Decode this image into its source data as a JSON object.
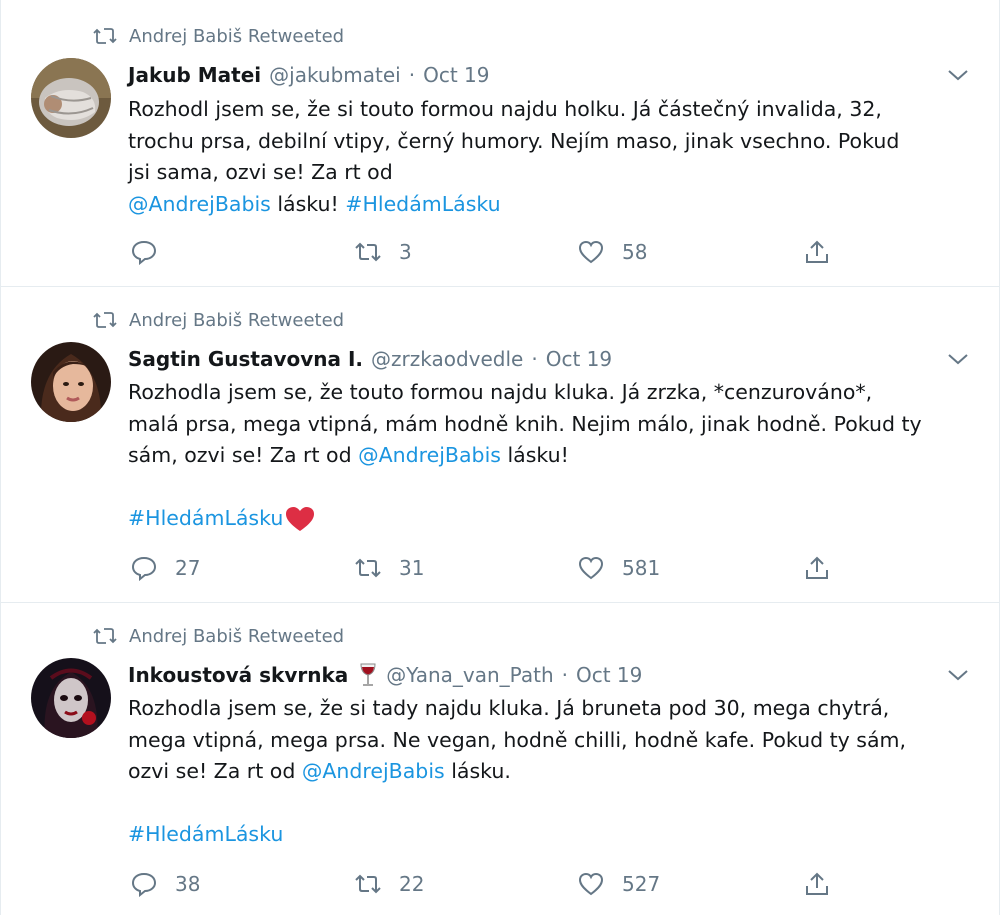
{
  "tweets": [
    {
      "retweeted_by": "Andrej Babiš Retweeted",
      "name": "Jakub Matei",
      "handle": "@jakubmatei",
      "date": "Oct 19",
      "lines": [
        [
          "Rozhodl jsem se, že si touto formou najdu holku. Já částečný invalida, 32,"
        ],
        [
          "trochu prsa, debilní vtipy, černý humory. Nejím maso, jinak vsechno. Pokud"
        ],
        [
          "jsi sama, ozvi se! Za rt od"
        ]
      ],
      "mention": "@AndrejBabis",
      "after_mention": " lásku! ",
      "hashtag": "#HledámLásku",
      "replies": "",
      "retweets": "3",
      "likes": "58"
    },
    {
      "retweeted_by": "Andrej Babiš Retweeted",
      "name": "Sagtin Gustavovna I.",
      "handle": "@zrzkaodvedle",
      "date": "Oct 19",
      "line1": "Rozhodla jsem se, že touto formou najdu kluka. Já zrzka, *cenzurováno*,",
      "line2": "malá prsa, mega vtipná, mám hodně knih. Nejim málo, jinak hodně. Pokud ty",
      "line3_pre": "sám, ozvi se! Za rt od ",
      "mention": "@AndrejBabis",
      "line3_post": " lásku!",
      "hashtag": "#HledámLásku",
      "replies": "27",
      "retweets": "31",
      "likes": "581"
    },
    {
      "retweeted_by": "Andrej Babiš Retweeted",
      "name": "Inkoustová skvrnka",
      "handle": "@Yana_van_Path",
      "date": "Oct 19",
      "line1": "Rozhodla jsem se, že si tady najdu kluka. Já bruneta pod 30, mega chytrá,",
      "line2": "mega vtipná, mega prsa. Ne vegan, hodně chilli, hodně kafe. Pokud ty sám,",
      "line3_pre": "ozvi se! Za rt od ",
      "mention": "@AndrejBabis",
      "line3_post": " lásku.",
      "hashtag": "#HledámLásku",
      "replies": "38",
      "retweets": "22",
      "likes": "527"
    }
  ],
  "icons": {
    "retweet": "retweet-icon",
    "reply": "reply-icon",
    "like": "heart-icon",
    "share": "share-icon",
    "chevron": "chevron-down-icon",
    "wine": "wine-glass-icon",
    "heart_emoji": "red-heart-emoji-icon"
  },
  "colors": {
    "link": "#1b95e0",
    "muted": "#657786",
    "text": "#14171a",
    "heart": "#dd2e44"
  }
}
